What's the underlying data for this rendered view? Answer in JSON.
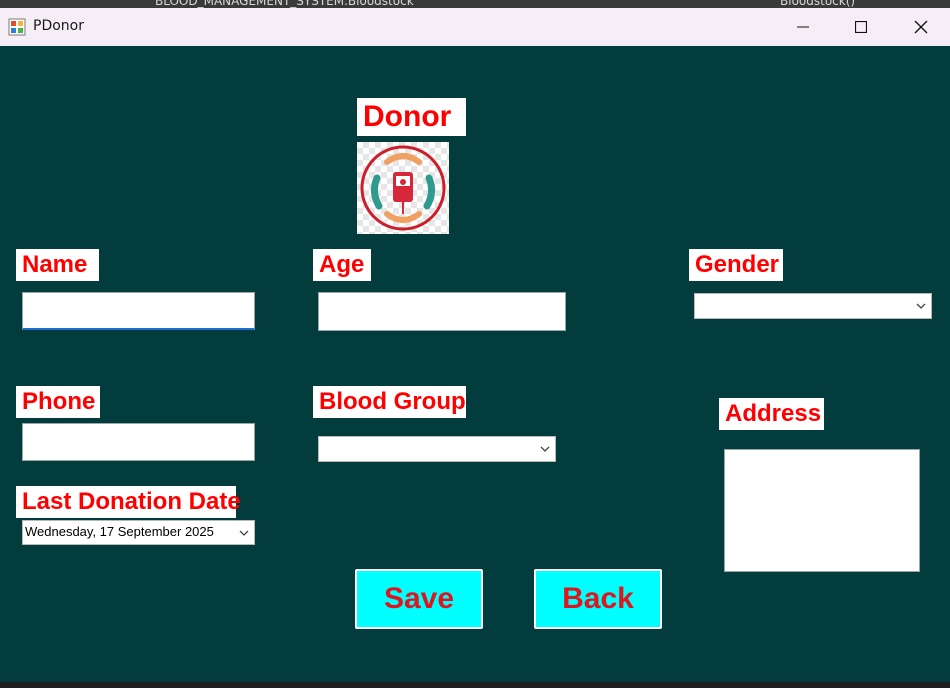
{
  "background_strip": {
    "left_text": "BLOOD_MANAGEMENT_SYSTEM.Bloodstock",
    "right_text": "Bloodstock()"
  },
  "window": {
    "title": "PDonor",
    "icon": "windows-forms-app-icon",
    "controls": [
      "minimize-icon",
      "maximize-icon",
      "close-icon"
    ]
  },
  "form": {
    "heading": "Donor",
    "logo": "blood-donation-logo",
    "labels": {
      "name": "Name",
      "age": "Age",
      "gender": "Gender",
      "phone": "Phone",
      "blood_group": "Blood Group",
      "address": "Address",
      "last_donation": "Last Donation Date"
    },
    "fields": {
      "name": "",
      "age": "",
      "gender": "",
      "phone": "",
      "blood_group": "",
      "address": "",
      "last_donation": "Wednesday, 17 September 2025"
    },
    "buttons": {
      "save": "Save",
      "back": "Back"
    }
  },
  "colors": {
    "form_background": "#023c3d",
    "label_text": "#ff0000",
    "button_background": "#00ffff",
    "button_text": "#e0161e",
    "focus_underline": "#1f6fd1"
  }
}
